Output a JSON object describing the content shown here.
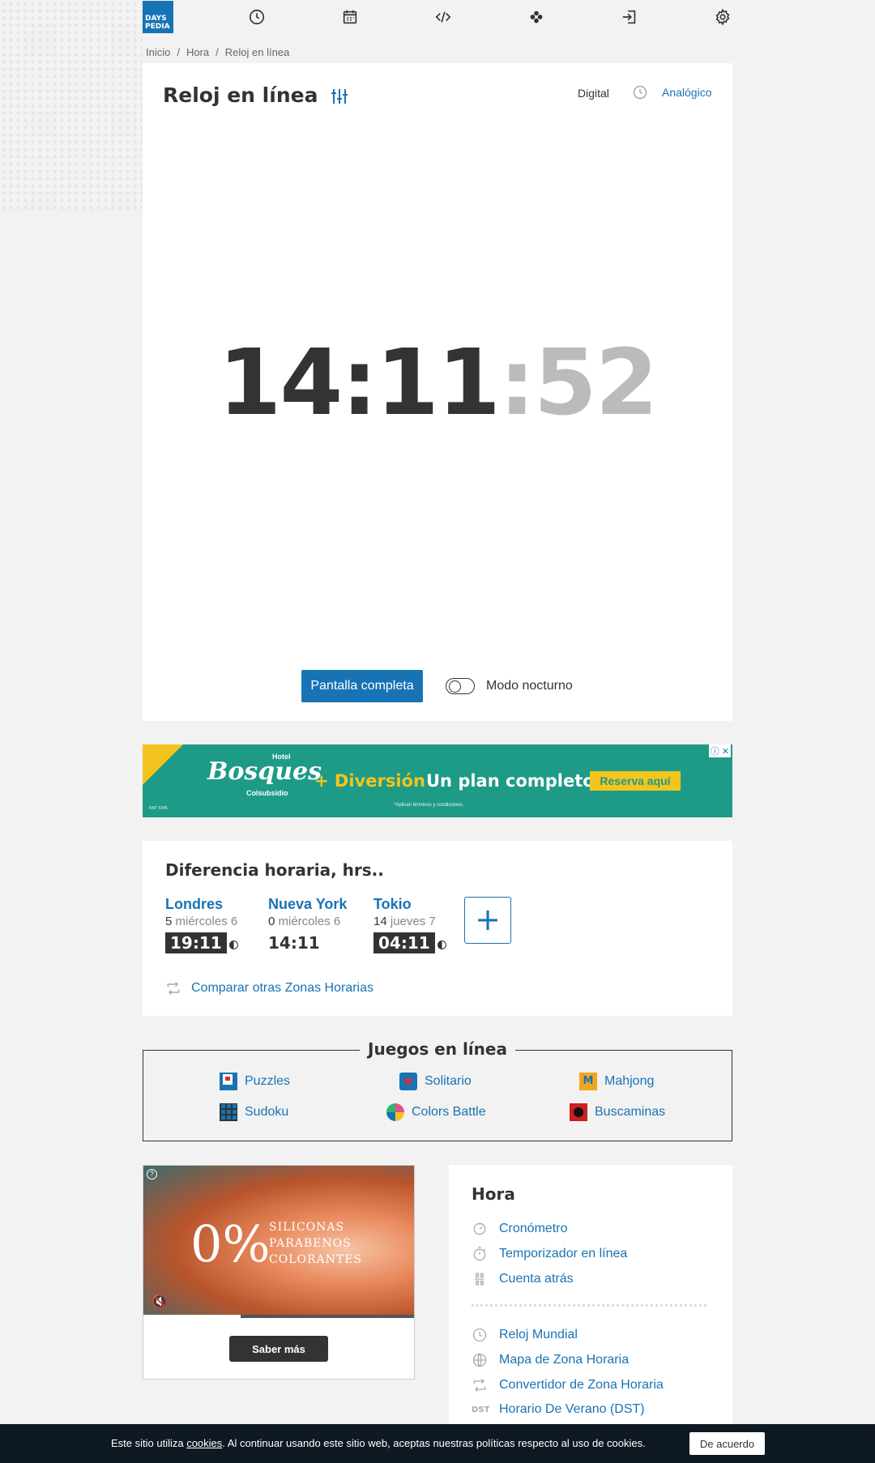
{
  "logo": {
    "line1": "DAYS",
    "line2": "PEDIA"
  },
  "breadcrumb": [
    "Inicio",
    "Hora",
    "Reloj en línea"
  ],
  "clock": {
    "title": "Reloj en línea",
    "mode_digital": "Digital",
    "mode_analog": "Analógico",
    "hours_minutes": "14:11",
    "seconds_sep": ":",
    "seconds": "52",
    "fullscreen_label": "Pantalla completa",
    "night_mode_label": "Modo nocturno"
  },
  "ad": {
    "brand_small": "Hotel",
    "brand": "Bosques",
    "brand_sub": "Colsubsidio",
    "plus": "+ Diversión",
    "plan": "Un plan completo",
    "cta": "Reserva aquí",
    "fine": "*Aplican términos y condiciones.",
    "rnt": "RNT 5346"
  },
  "time_difference": {
    "title": "Diferencia horaria, hrs..",
    "cities": [
      {
        "name": "Londres",
        "offset": "5",
        "day": "miércoles 6",
        "time": "19:11",
        "style": "dark"
      },
      {
        "name": "Nueva York",
        "offset": "0",
        "day": "miércoles 6",
        "time": "14:11",
        "style": "light"
      },
      {
        "name": "Tokio",
        "offset": "14",
        "day": "jueves 7",
        "time": "04:11",
        "style": "dark"
      }
    ],
    "add_label": "+",
    "compare_label": "Comparar otras Zonas Horarias"
  },
  "games": {
    "title": "Juegos en línea",
    "items": [
      {
        "label": "Puzzles",
        "icon": "puzzles-icon",
        "color": "#1873b5"
      },
      {
        "label": "Solitario",
        "icon": "solitaire-heart-icon",
        "color": "#d9302c"
      },
      {
        "label": "Mahjong",
        "icon": "mahjong-icon",
        "color": "#f3a61d"
      },
      {
        "label": "Sudoku",
        "icon": "sudoku-grid-icon",
        "color": "#1873b5"
      },
      {
        "label": "Colors Battle",
        "icon": "colors-battle-icon",
        "color": "#e94f8a"
      },
      {
        "label": "Buscaminas",
        "icon": "minesweeper-icon",
        "color": "#cc1f1f"
      }
    ]
  },
  "video_ad": {
    "big": "0%",
    "text_lines": [
      "SILICONAS",
      "PARABENOS",
      "COLORANTES"
    ],
    "more_label": "Saber más",
    "progress": 0.36
  },
  "hora": {
    "title": "Hora",
    "links_top": [
      {
        "label": "Cronómetro",
        "icon": "stopwatch-icon"
      },
      {
        "label": "Temporizador en línea",
        "icon": "timer-icon"
      },
      {
        "label": "Cuenta atrás",
        "icon": "countdown-icon"
      }
    ],
    "links_bottom": [
      {
        "label": "Reloj Mundial",
        "icon": "clock-icon"
      },
      {
        "label": "Mapa de Zona Horaria",
        "icon": "globe-icon"
      },
      {
        "label": "Convertidor de Zona Horaria",
        "icon": "convert-icon"
      },
      {
        "label": "Horario De Verano (DST)",
        "icon": "dst-icon",
        "icon_text": "DST"
      }
    ]
  },
  "cookie": {
    "text_before": "Este sitio utiliza ",
    "link": "cookies",
    "text_after": ". Al continuar usando este sitio web, aceptas nuestras políticas respecto al uso de cookies.",
    "accept_label": "De acuerdo"
  },
  "colors": {
    "accent": "#1873b5",
    "text": "#333333",
    "seconds": "#bbbbbb",
    "cookie_bg": "#0f1923"
  }
}
